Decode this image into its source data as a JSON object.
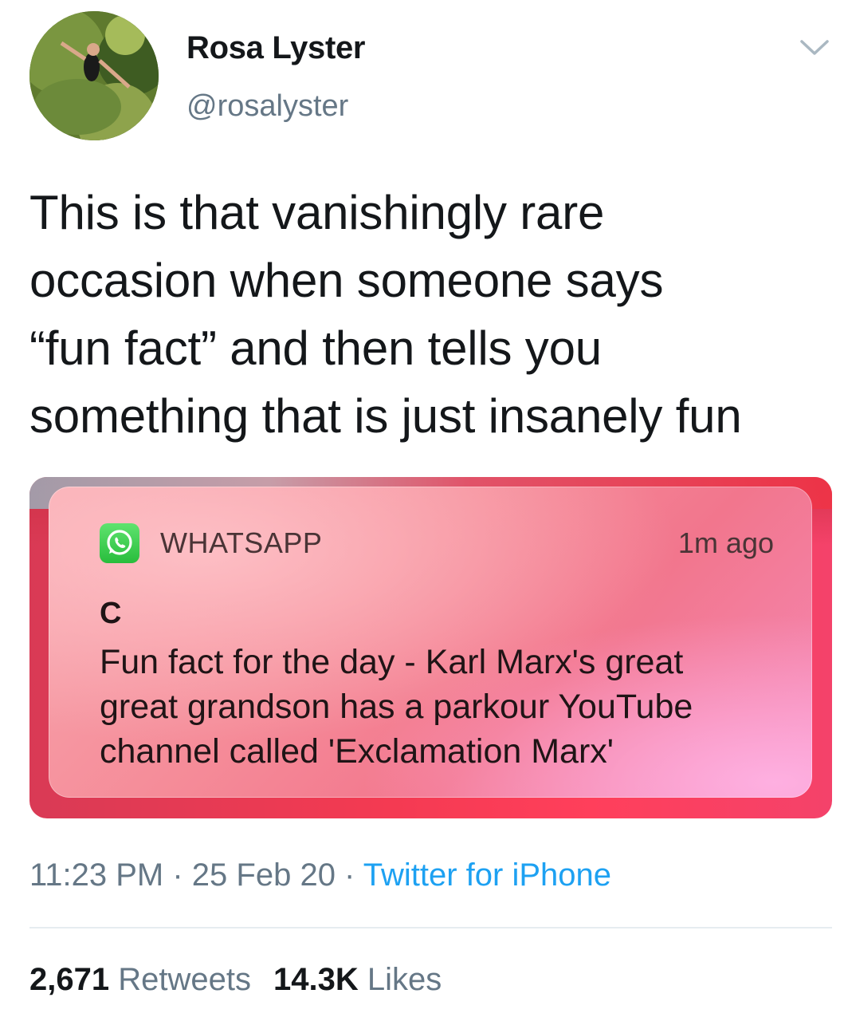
{
  "author": {
    "display_name": "Rosa Lyster",
    "handle": "@rosalyster"
  },
  "tweet": {
    "text_lines": [
      "This is that vanishingly rare",
      "occasion when someone says",
      "“fun fact” and then tells you",
      "something that is just insanely fun"
    ]
  },
  "notification": {
    "app_name": "WHATSAPP",
    "time": "1m ago",
    "sender": "C",
    "message_lines": [
      "Fun fact for the day - Karl Marx's great",
      "great grandson has a parkour YouTube",
      "channel called 'Exclamation Marx'"
    ],
    "icon": "whatsapp-icon"
  },
  "meta": {
    "time": "11:23 PM",
    "separator": " · ",
    "date": "25 Feb 20",
    "source": "Twitter for iPhone"
  },
  "stats": {
    "retweets_count": "2,671",
    "retweets_label": "Retweets",
    "likes_count": "14.3K",
    "likes_label": "Likes"
  },
  "colors": {
    "link": "#1da1f2",
    "secondary_text": "#657786",
    "notification_accent": "#f2768d"
  }
}
